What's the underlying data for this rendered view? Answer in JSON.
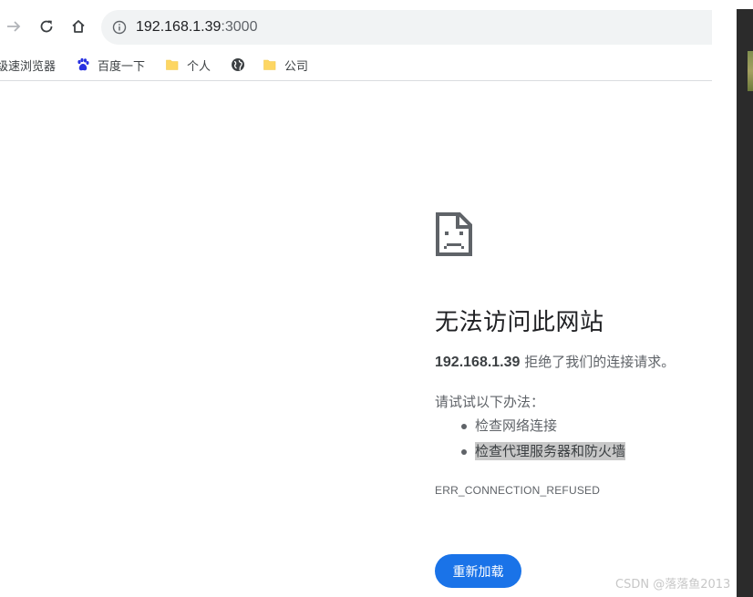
{
  "toolbar": {
    "forward_icon": "arrow-right-icon",
    "reload_icon": "reload-icon",
    "home_icon": "home-icon",
    "url_host": "192.168.1.39",
    "url_port": ":3000",
    "info_icon": "info-icon"
  },
  "bookmarks": {
    "items": [
      {
        "label": "级速浏览器",
        "icon": "none"
      },
      {
        "label": "百度一下",
        "icon": "baidu-paw-icon"
      },
      {
        "label": "个人",
        "icon": "folder-icon"
      },
      {
        "label": "",
        "icon": "globe-icon"
      },
      {
        "label": "公司",
        "icon": "folder-icon"
      }
    ]
  },
  "error": {
    "icon": "sad-page-icon",
    "title": "无法访问此网站",
    "host": "192.168.1.39",
    "message": " 拒绝了我们的连接请求。",
    "try_label": "请试试以下办法：",
    "suggestions": [
      "检查网络连接",
      "检查代理服务器和防火墙"
    ],
    "code": "ERR_CONNECTION_REFUSED",
    "reload_label": "重新加载"
  },
  "watermark": "CSDN @落落鱼2013",
  "colors": {
    "accent": "#1a73e8",
    "text": "#202124",
    "secondary_text": "#5f6368",
    "omnibox_bg": "#f1f3f4",
    "highlight": "#c8c8c8",
    "folder": "#fdd663"
  }
}
